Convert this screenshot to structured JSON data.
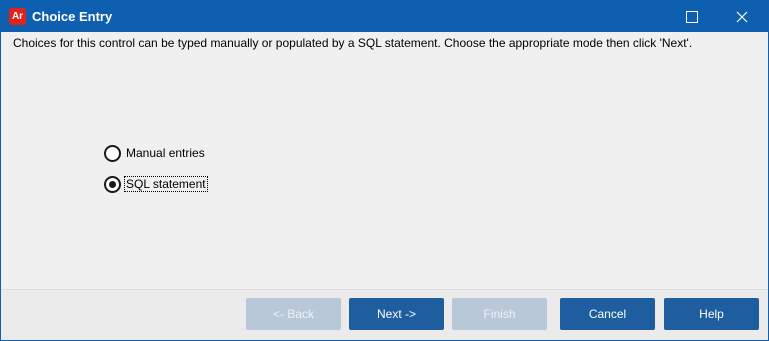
{
  "window": {
    "app_icon_text": "Ar",
    "title": "Choice Entry",
    "maximize_icon": "maximize-icon",
    "close_icon": "close-icon"
  },
  "content": {
    "description": "Choices for this control can be typed manually or populated by a SQL statement.  Choose the appropriate mode then click 'Next'.",
    "options": [
      {
        "label": "Manual entries",
        "selected": false
      },
      {
        "label": "SQL statement",
        "selected": true
      }
    ]
  },
  "buttons": {
    "back": {
      "label": "<- Back",
      "enabled": false
    },
    "next": {
      "label": "Next ->",
      "enabled": true
    },
    "finish": {
      "label": "Finish",
      "enabled": false
    },
    "cancel": {
      "label": "Cancel",
      "enabled": true
    },
    "help": {
      "label": "Help",
      "enabled": true
    }
  },
  "colors": {
    "titlebar": "#0f5fb0",
    "button_primary": "#1f5e9e",
    "button_disabled": "#b9c8d9",
    "app_icon": "#e0221b"
  }
}
